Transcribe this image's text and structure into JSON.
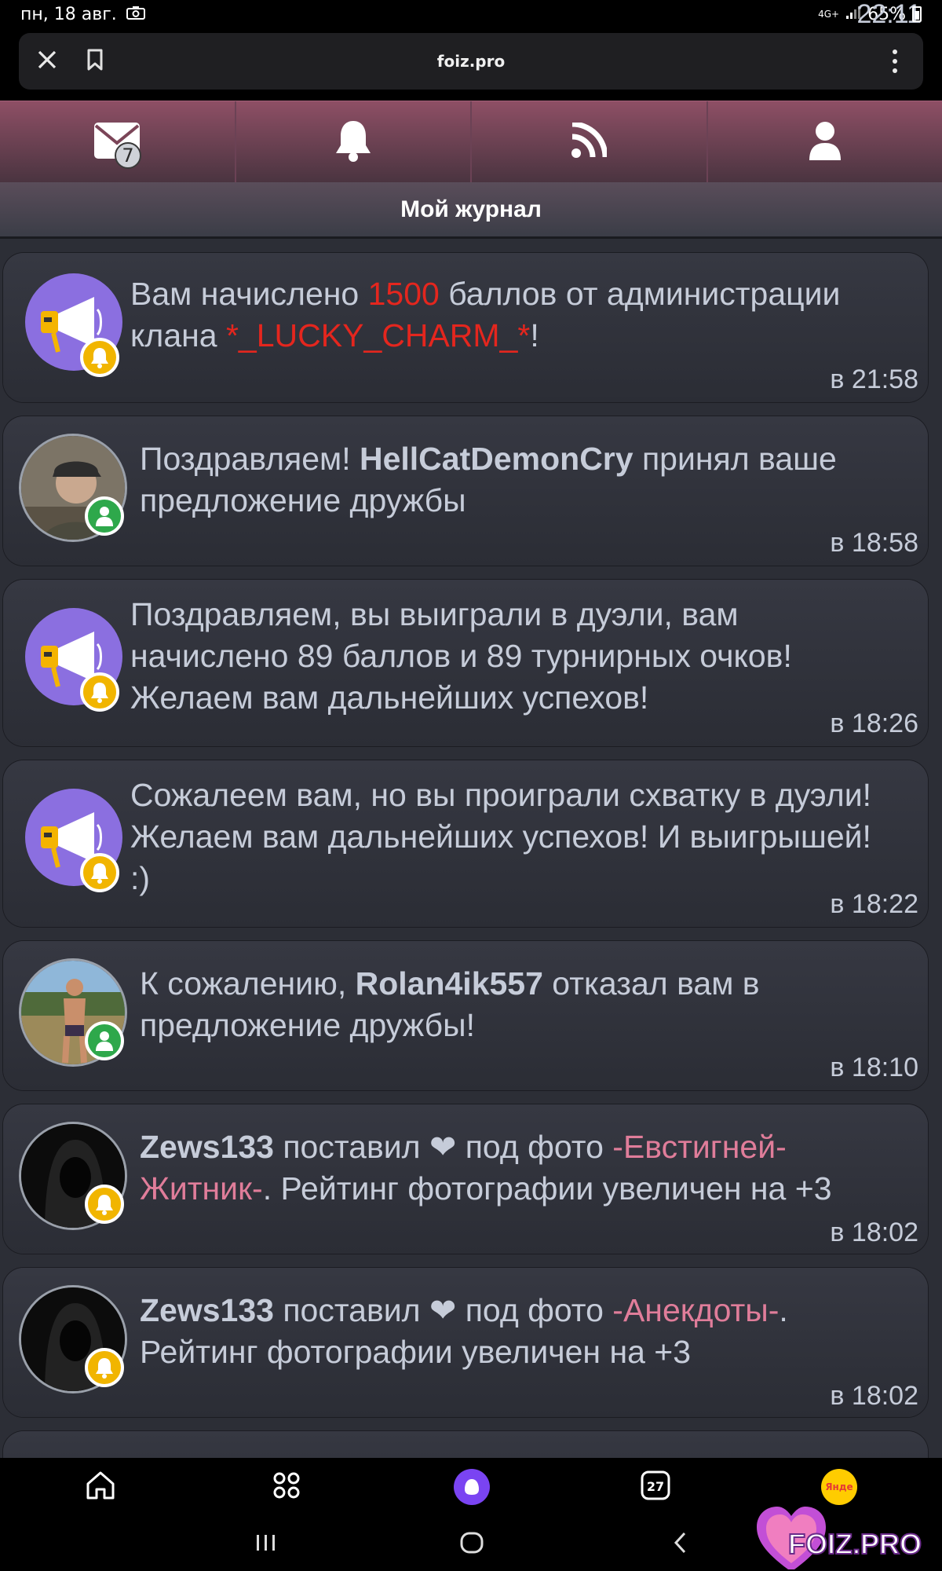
{
  "status_bar": {
    "time": "22:11",
    "date": "пн, 18 авг.",
    "network": "4G+",
    "battery": "65%"
  },
  "browser": {
    "url": "foiz.pro"
  },
  "nav": {
    "messages_badge": "7"
  },
  "page": {
    "title": "Мой журнал"
  },
  "feed": [
    {
      "avatar": "megaphone-icon",
      "badge": "bell-icon",
      "parts": [
        "Вам начислено ",
        "1500",
        " баллов от администрации клана ",
        "*_LUCKY_CHARM_*",
        "!"
      ],
      "time": "в 21:58"
    },
    {
      "avatar": "user-photo",
      "badge": "user-icon",
      "parts": [
        "Поздравляем! ",
        "HellCatDemonCry",
        " принял ваше предложение дружбы"
      ],
      "time": "в 18:58"
    },
    {
      "avatar": "megaphone-icon",
      "badge": "bell-icon",
      "parts": [
        "Поздравляем, вы выиграли в дуэли, вам начислено 89 баллов и 89 турнирных очков! Желаем вам дальнейших успехов!"
      ],
      "time": "в 18:26"
    },
    {
      "avatar": "megaphone-icon",
      "badge": "bell-icon",
      "parts": [
        "Сожалеем вам, но вы проиграли схватку в дуэли! Желаем вам дальнейших успехов! И выигрышей! :)"
      ],
      "time": "в 18:22"
    },
    {
      "avatar": "user-photo",
      "badge": "user-icon",
      "parts": [
        "К сожалению, ",
        "Rolan4ik557",
        " отказал вам в предложение дружбы!"
      ],
      "time": "в 18:10"
    },
    {
      "avatar": "user-photo",
      "badge": "bell-icon",
      "parts": [
        "Zews133",
        " поставил ",
        "❤",
        " под фото ",
        "-Евстигней-Житник-",
        ". Рейтинг фотографии увеличен на +3"
      ],
      "time": "в 18:02"
    },
    {
      "avatar": "user-photo",
      "badge": "bell-icon",
      "parts": [
        "Zews133",
        " поставил ",
        "❤",
        " под фото ",
        "-Анекдоты-",
        ". Рейтинг фотографии увеличен на +3"
      ],
      "time": "в 18:02"
    }
  ],
  "bottom_nav": {
    "calendar_day": "27",
    "yandex_label": "Янде"
  },
  "watermark": {
    "text": "FOIZ.PRO"
  },
  "colors": {
    "accent_red": "#e4261e",
    "link_pink": "#e07d9a",
    "nav_gradient_top": "#8e4f65",
    "bell_badge": "#f1b500",
    "user_badge": "#2ea84b",
    "avatar_purple": "#8b6fe0"
  }
}
